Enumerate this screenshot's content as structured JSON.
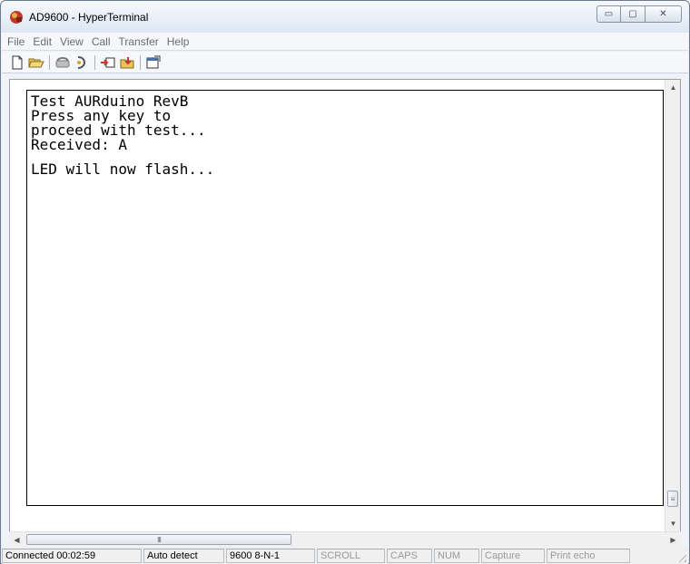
{
  "window": {
    "title": "AD9600 - HyperTerminal",
    "caption_buttons": {
      "minimize": "▭",
      "maximize": "▢",
      "close": "✕"
    }
  },
  "menu": {
    "items": [
      "File",
      "Edit",
      "View",
      "Call",
      "Transfer",
      "Help"
    ]
  },
  "toolbar": {
    "buttons": [
      "new-connection-icon",
      "open-folder-icon",
      "disconnect-phone-icon",
      "dial-icon",
      "send-icon",
      "receive-icon",
      "properties-icon"
    ]
  },
  "terminal": {
    "lines": [
      "Test AURduino RevB",
      "Press any key to",
      "proceed with test...",
      "Received: A"
    ],
    "lines_after_gap": [
      "LED will now flash..."
    ]
  },
  "scrollbars": {
    "h_thumb_grip": "III",
    "v_thumb_grip": "≡"
  },
  "status": {
    "connected": "Connected 00:02:59",
    "detect": "Auto detect",
    "settings": "9600 8-N-1",
    "scroll": "SCROLL",
    "caps": "CAPS",
    "num": "NUM",
    "capture": "Capture",
    "print_echo": "Print echo"
  },
  "colors": {
    "titlebar": "#dde7f3",
    "terminal_bg": "#ffffff",
    "status_dim": "#9a9a9a"
  }
}
